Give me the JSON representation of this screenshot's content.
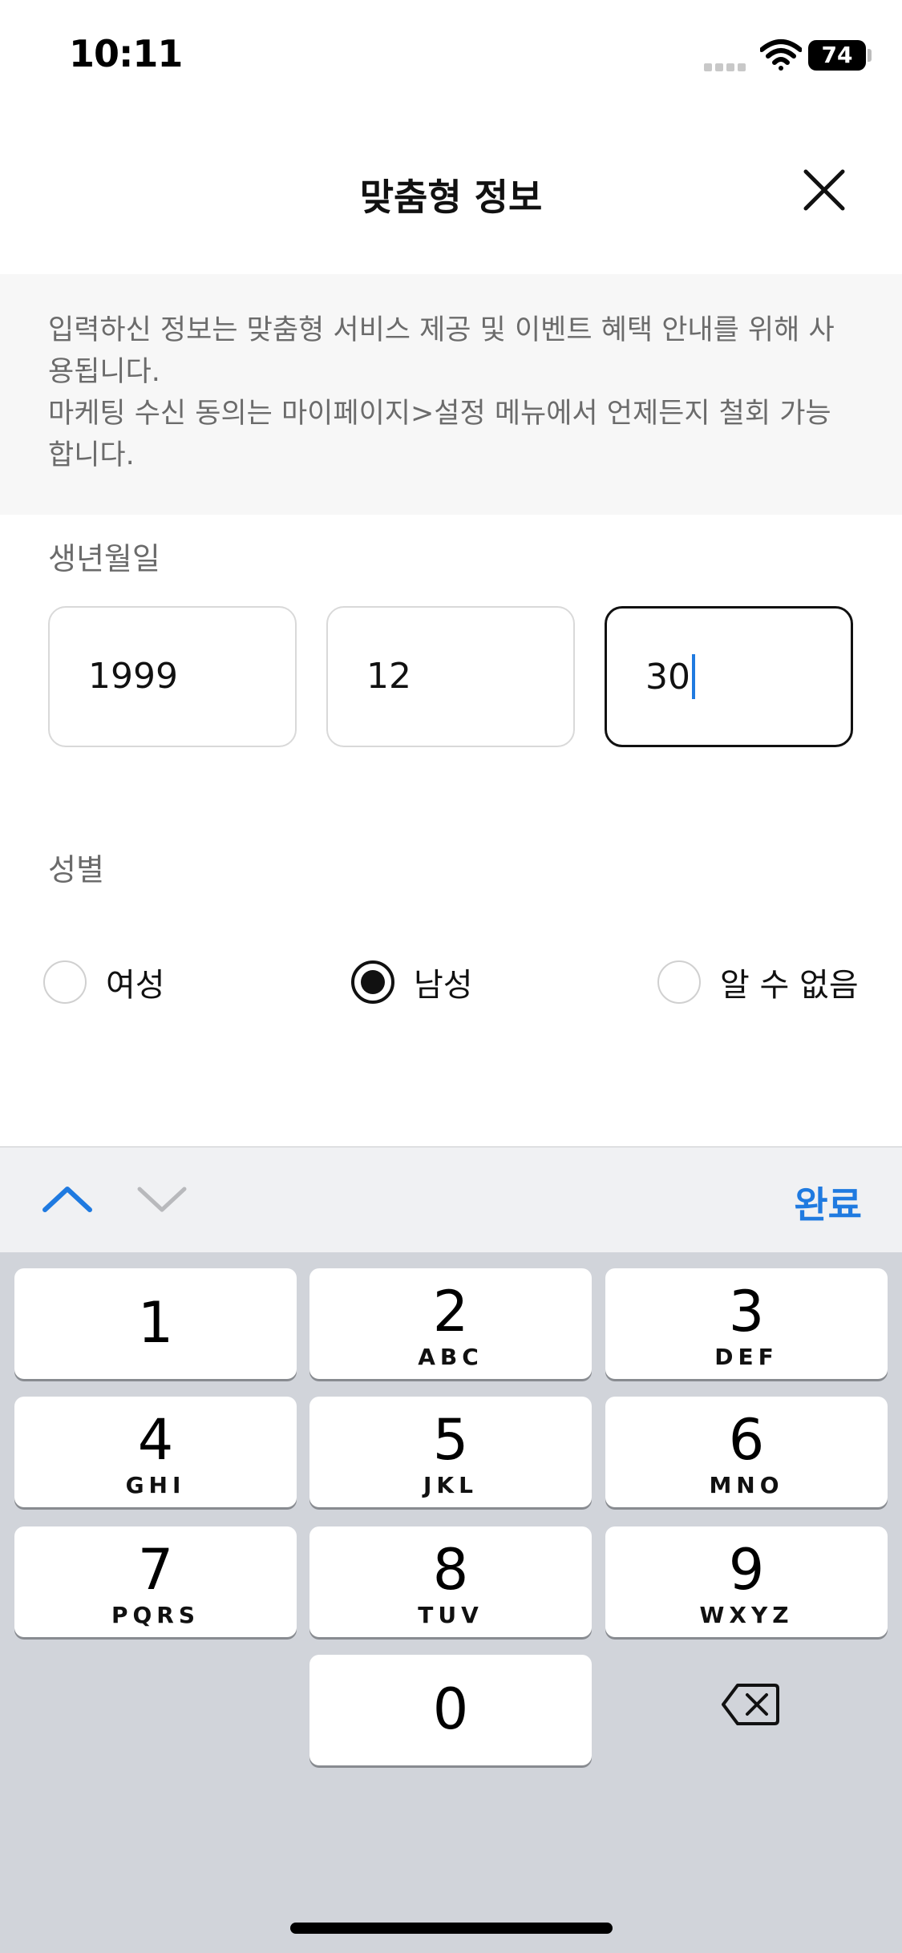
{
  "status_bar": {
    "time": "10:11",
    "battery": "74"
  },
  "header": {
    "title": "맞춤형 정보"
  },
  "notice": {
    "line1": "입력하신 정보는 맞춤형 서비스 제공 및 이벤트 혜택 안내를 위해 사용됩니다.",
    "line2": "마케팅 수신 동의는 마이페이지>설정 메뉴에서 언제든지 철회 가능합니다."
  },
  "birth": {
    "label": "생년월일",
    "year": "1999",
    "month": "12",
    "day": "30"
  },
  "gender": {
    "label": "성별",
    "options": [
      "여성",
      "남성",
      "알 수 없음"
    ],
    "selected": "남성"
  },
  "accessory": {
    "done_label": "완료"
  },
  "keypad": {
    "keys": [
      {
        "num": "1",
        "letters": ""
      },
      {
        "num": "2",
        "letters": "ABC"
      },
      {
        "num": "3",
        "letters": "DEF"
      },
      {
        "num": "4",
        "letters": "GHI"
      },
      {
        "num": "5",
        "letters": "JKL"
      },
      {
        "num": "6",
        "letters": "MNO"
      },
      {
        "num": "7",
        "letters": "PQRS"
      },
      {
        "num": "8",
        "letters": "TUV"
      },
      {
        "num": "9",
        "letters": "WXYZ"
      },
      {
        "num": "0",
        "letters": ""
      }
    ]
  },
  "colors": {
    "accent": "#1f7ae0",
    "keyboard_bg": "#d1d4da",
    "notice_bg": "#f7f7f7"
  }
}
